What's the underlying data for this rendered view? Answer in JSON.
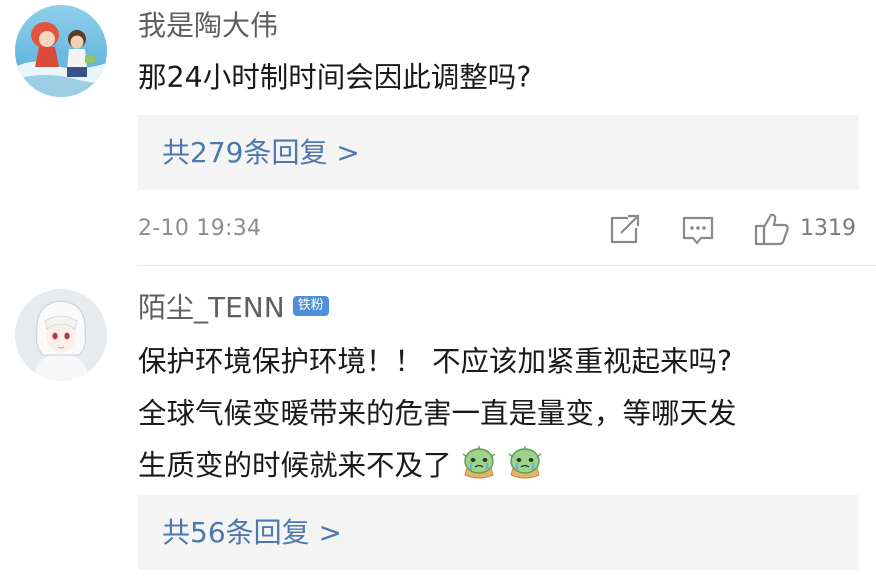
{
  "comments": [
    {
      "username": "我是陶大伟",
      "avatar_icon": "anime-character-avatar",
      "content_lines": [
        "那24小时制时间会因此调整吗?"
      ],
      "replies_label": "共279条回复 >",
      "timestamp": "2-10 19:34",
      "like_count": "1319",
      "actions": [
        "share-icon",
        "comment-icon",
        "thumbs-up-icon"
      ]
    },
    {
      "username": "陌尘_TENN",
      "badge": "铁粉",
      "avatar_icon": "white-haired-character-avatar",
      "content_lines": [
        "保护环境保护环境！！ 不应该加紧重视起来吗?",
        "全球气候变暖带来的危害一直是量变，等哪天发",
        "生质变的时候就来不及了"
      ],
      "emojis": [
        "crying-cactus-emoji",
        "crying-cactus-emoji"
      ],
      "replies_label": "共56条回复 >"
    }
  ],
  "colors": {
    "username": "#5f5f5f",
    "link": "#4c78ad",
    "badge": "#4f8fd8",
    "reply_box": "#f4f4f4",
    "meta": "#8d8d8d"
  }
}
